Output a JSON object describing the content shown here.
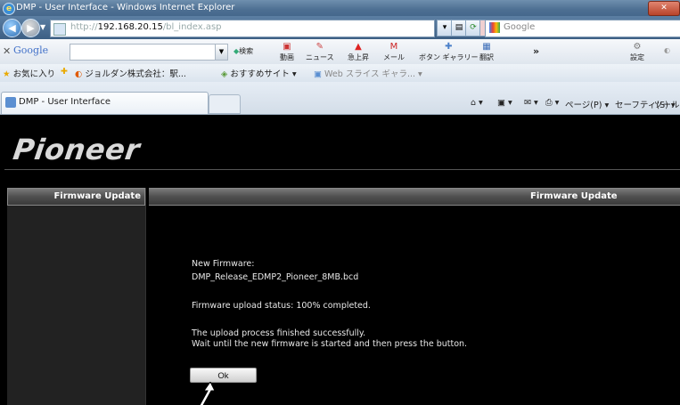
{
  "window": {
    "title": "DMP - User Interface - Windows Internet Explorer"
  },
  "address_bar": {
    "url_prefix": "http://",
    "url_host": "192.168.20.15",
    "url_path": "/bl_index.asp",
    "search_label": "Google"
  },
  "google_toolbar": {
    "logo": "Google",
    "items": [
      {
        "icon": "search-icon",
        "label": "検索"
      },
      {
        "icon": "video-icon",
        "label": "動画"
      },
      {
        "icon": "news-icon",
        "label": "ニュース"
      },
      {
        "icon": "trending-icon",
        "label": "急上昇"
      },
      {
        "icon": "mail-icon",
        "label": "メール"
      },
      {
        "icon": "gallery-icon",
        "label": "ボタン ギャラリー"
      },
      {
        "icon": "translate-icon",
        "label": "翻訳"
      },
      {
        "icon": "more-icon",
        "label": "»"
      },
      {
        "icon": "settings-icon",
        "label": "設定"
      }
    ]
  },
  "favorites_bar": {
    "favorites_label": "お気に入り",
    "items": [
      "ジョルダン株式会社：駅...",
      "おすすめサイト ▾",
      "Web スライス ギャラ... ▾"
    ]
  },
  "tabs": [
    {
      "label": "DMP - User Interface"
    }
  ],
  "command_bar": {
    "page_label": "ページ(P) ▾",
    "safety_label": "セーフティ(S) ▾",
    "tools_label": "ツール(O)"
  },
  "page": {
    "brand": "Pioneer",
    "sidebar_header": "Firmware Update",
    "main_header": "Firmware Update",
    "new_firmware_label": "New Firmware:",
    "firmware_file": "DMP_Release_EDMP2_Pioneer_8MB.bcd",
    "upload_status": "Firmware upload status: 100% completed.",
    "message_line1": "The upload process finished successfully.",
    "message_line2": "Wait until the new firmware is started and then press the button.",
    "ok_label": "Ok"
  }
}
